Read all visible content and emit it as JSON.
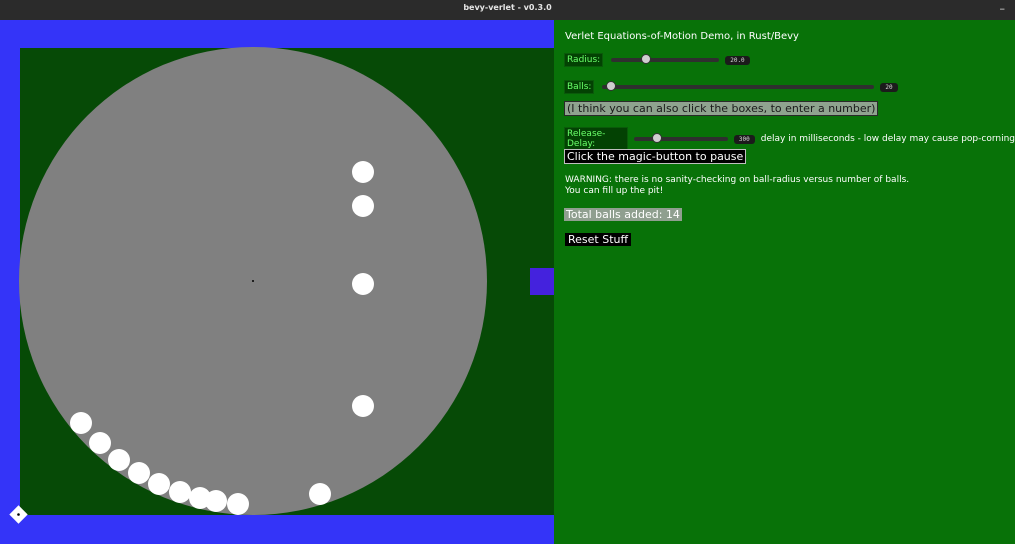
{
  "window": {
    "title": "bevy-verlet - v0.3.0",
    "minimize_glyph": "–"
  },
  "colors": {
    "sim_background": "#3434f8",
    "pit_background": "#064a06",
    "arena_circle": "#808080",
    "ball": "#ffffff",
    "panel_background": "#087208",
    "label_text": "#6aff6a"
  },
  "panel": {
    "heading": "Verlet Equations-of-Motion Demo, in Rust/Bevy",
    "radius": {
      "label": "Radius:",
      "value": "20.0",
      "fraction": 0.32
    },
    "balls": {
      "label": "Balls:",
      "value": "20",
      "fraction": 0.03
    },
    "click_hint": "(I think you can also click the boxes, to enter a number)",
    "release_delay": {
      "label": "Release-Delay:",
      "value": "300",
      "fraction": 0.24,
      "note": "delay in milliseconds - low delay may cause pop-corning"
    },
    "magic_button": "Click the magic-button to pause",
    "warning_line1": "WARNING: there is no sanity-checking on ball-radius versus number of balls.",
    "warning_line2": "You can fill up the pit!",
    "total_balls": "Total balls added: 14",
    "reset_button": "Reset Stuff"
  },
  "simulation": {
    "ball_count": 14
  }
}
